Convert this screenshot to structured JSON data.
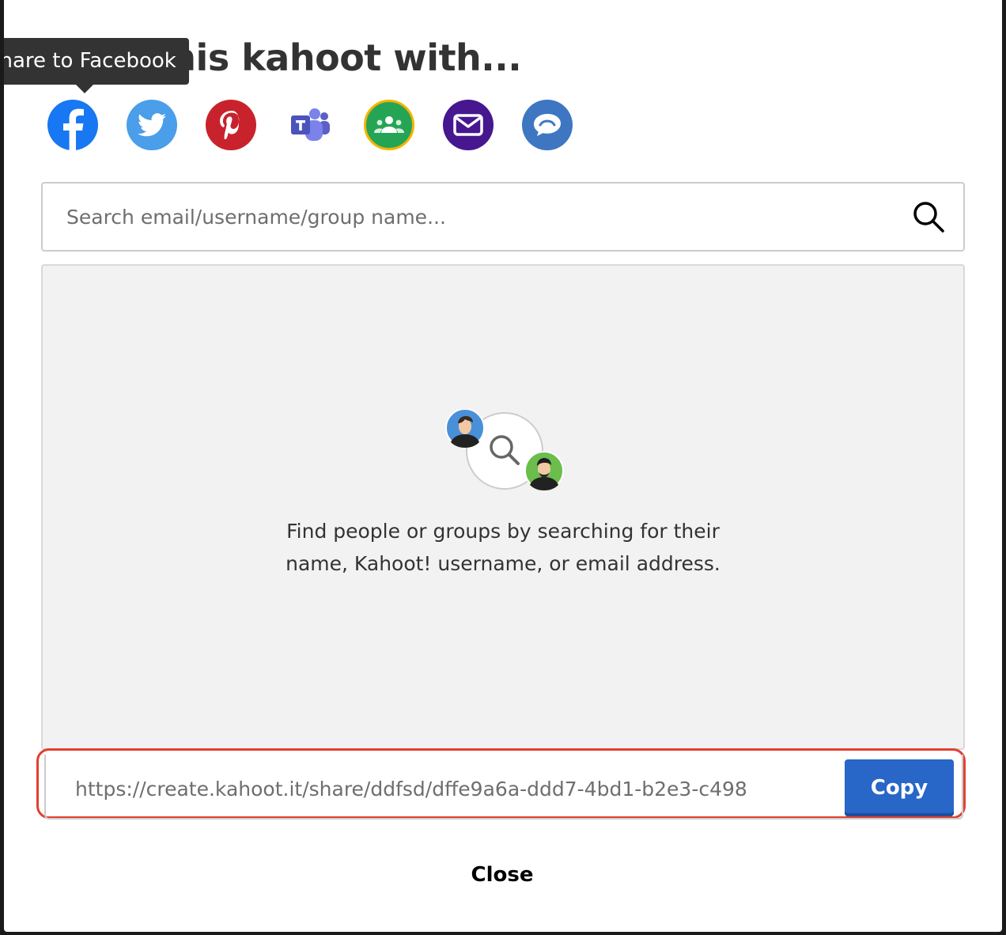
{
  "modal": {
    "title": "Share this kahoot with...",
    "tooltip": "Share to Facebook"
  },
  "share_buttons": [
    {
      "name": "facebook",
      "icon": "facebook-icon",
      "color": "#1877f2"
    },
    {
      "name": "twitter",
      "icon": "twitter-icon",
      "color": "#4a9eea"
    },
    {
      "name": "pinterest",
      "icon": "pinterest-icon",
      "color": "#c8232c"
    },
    {
      "name": "teams",
      "icon": "microsoft-teams-icon",
      "color": "#5b5fc7"
    },
    {
      "name": "google-classroom",
      "icon": "google-classroom-icon",
      "color": "#25a456"
    },
    {
      "name": "email",
      "icon": "email-icon",
      "color": "#46178f"
    },
    {
      "name": "remind",
      "icon": "remind-icon",
      "color": "#3e76c2"
    }
  ],
  "search": {
    "placeholder": "Search email/username/group name...",
    "value": ""
  },
  "results": {
    "empty_line1": "Find people or groups by searching for their",
    "empty_line2": "name, Kahoot! username, or email address."
  },
  "link": {
    "url": "https://create.kahoot.it/share/ddfsd/dffe9a6a-ddd7-4bd1-b2e3-c498",
    "copy_label": "Copy",
    "highlight_color": "#e2402f"
  },
  "footer": {
    "close_label": "Close"
  }
}
